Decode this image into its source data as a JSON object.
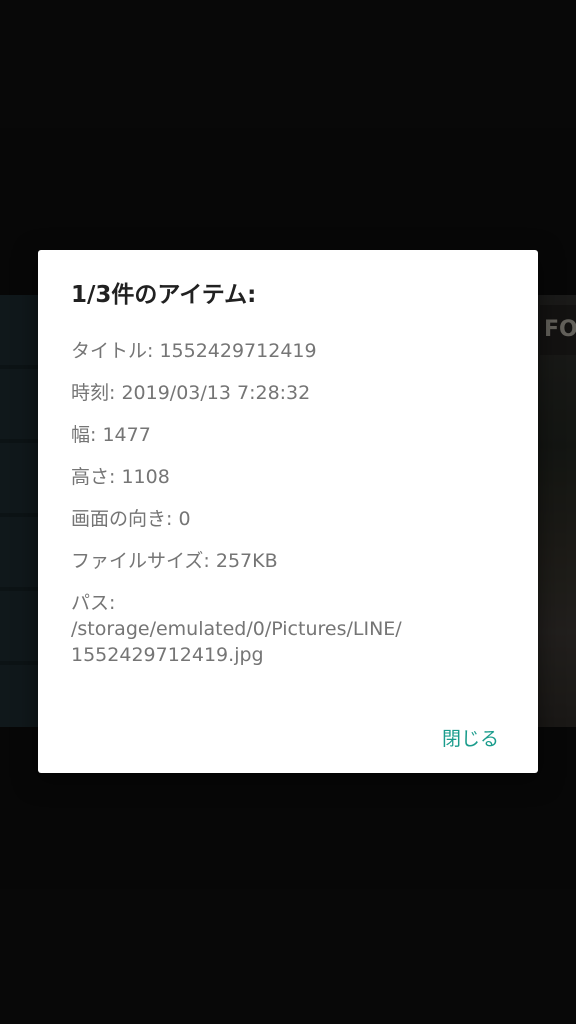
{
  "dialog": {
    "title": "1/3件のアイテム:",
    "details": {
      "title_row": "タイトル: 1552429712419",
      "time_row": "時刻: 2019/03/13 7:28:32",
      "width_row": "幅: 1477",
      "height_row": "高さ: 1108",
      "orientation_row": "画面の向き: 0",
      "filesize_row": "ファイルサイズ: 257KB",
      "path_label": "パス:",
      "path_line1": "/storage/emulated/0/Pictures/LINE/",
      "path_line2": "1552429712419.jpg"
    },
    "close_label": "閉じる"
  },
  "background": {
    "shop_sign_text": "FO"
  },
  "colors": {
    "accent": "#1a9c8c",
    "title_text": "#212121",
    "detail_text": "#757575",
    "dialog_bg": "#ffffff",
    "screen_bg": "#111111"
  }
}
